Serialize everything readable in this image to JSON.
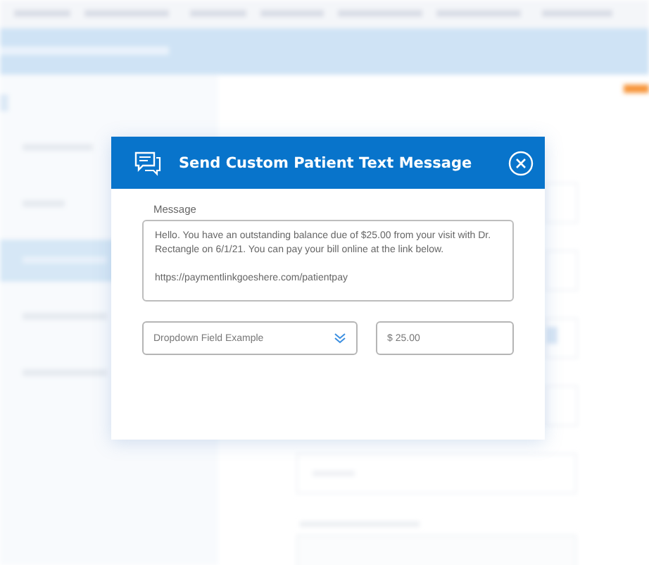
{
  "dialog": {
    "title": "Send Custom Patient Text Message",
    "message": {
      "label": "Message",
      "value": "Hello. You have an outstanding balance due of $25.00 from your visit with Dr. Rectangle on 6/1/21. You can pay your bill online at the link below.\n\nhttps://paymentlinkgoeshere.com/patientpay"
    },
    "dropdown": {
      "value": "Dropdown Field Example"
    },
    "amount": {
      "value": "$ 25.00"
    }
  }
}
